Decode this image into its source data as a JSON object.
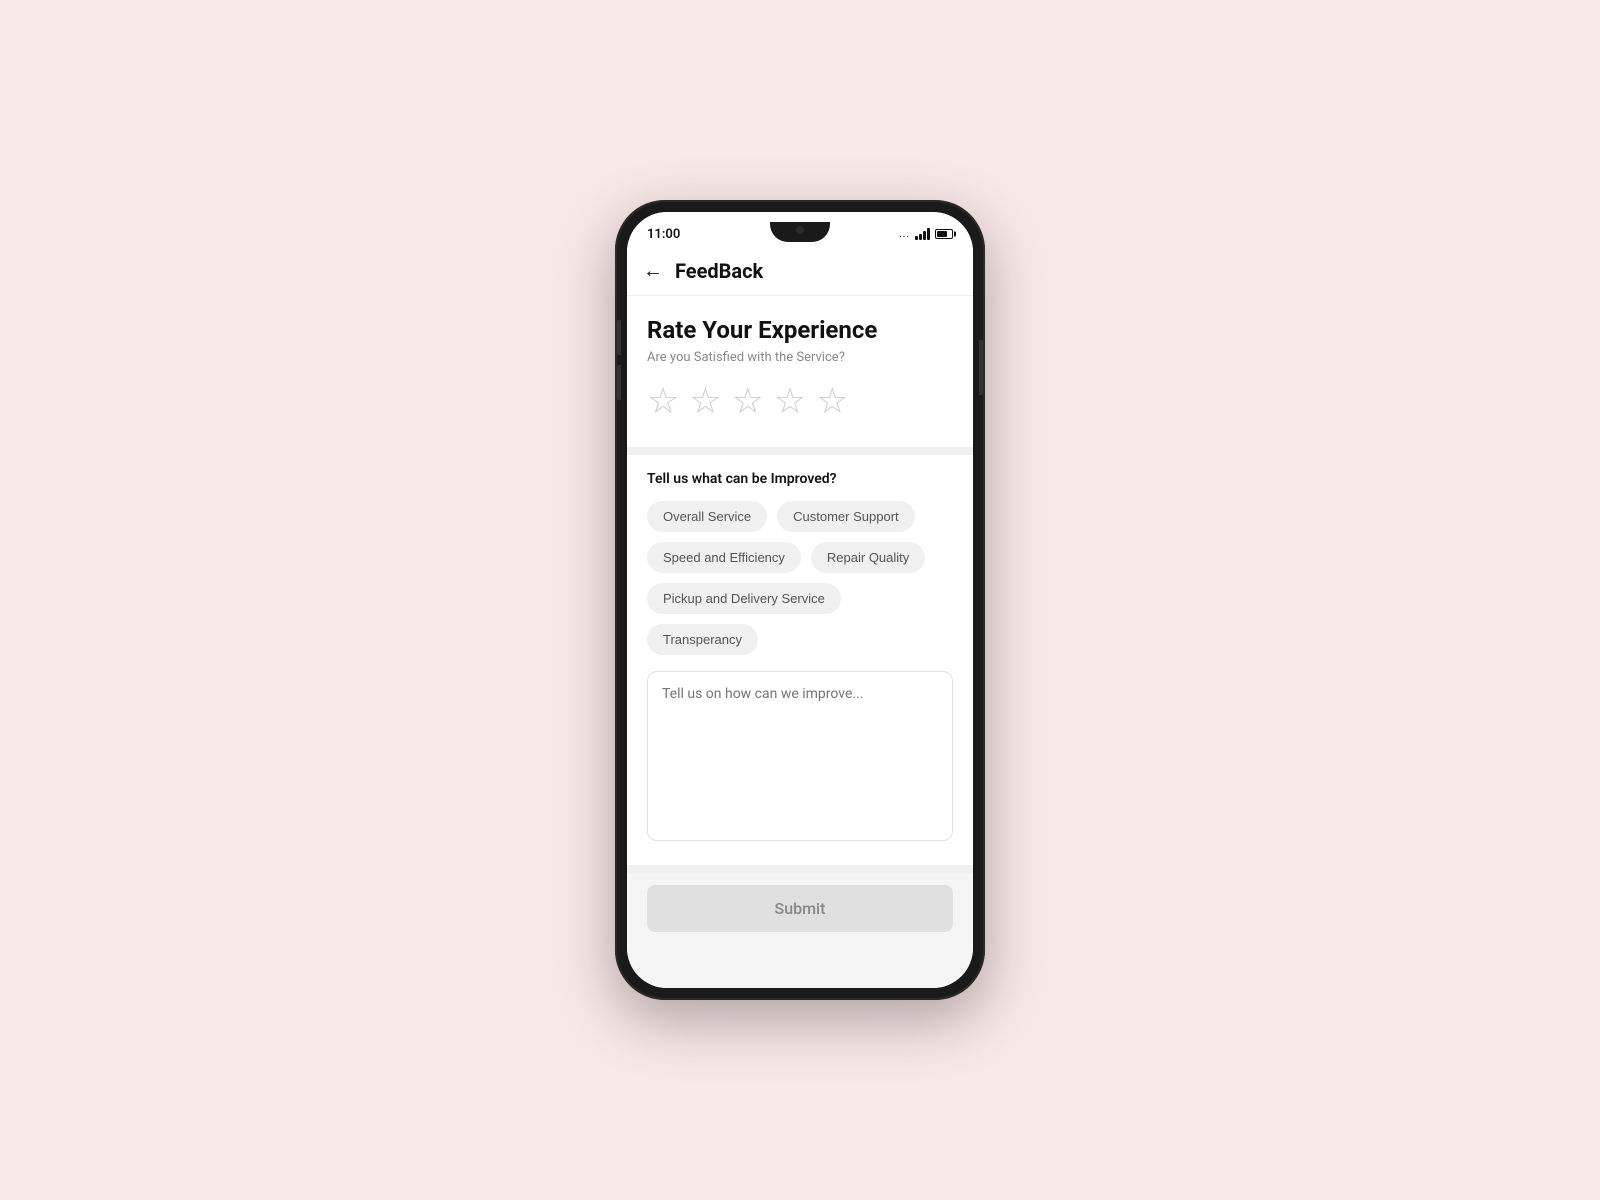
{
  "status_bar": {
    "time": "11:00",
    "dots": "...",
    "wifi": "▼",
    "signal_label": "signal"
  },
  "header": {
    "back_icon": "←",
    "title": "FeedBack"
  },
  "rate_section": {
    "title": "Rate Your Experience",
    "subtitle": "Are you Satisfied with the Service?",
    "stars": [
      "★",
      "★",
      "★",
      "★",
      "★"
    ]
  },
  "improve_section": {
    "title": "Tell us what can be Improved?",
    "tags": [
      "Overall Service",
      "Customer Support",
      "Speed and Efficiency",
      "Repair Quality",
      "Pickup and Delivery Service",
      "Transperancy"
    ]
  },
  "textarea": {
    "placeholder": "Tell us on how can we improve..."
  },
  "submit_button": {
    "label": "Submit"
  }
}
